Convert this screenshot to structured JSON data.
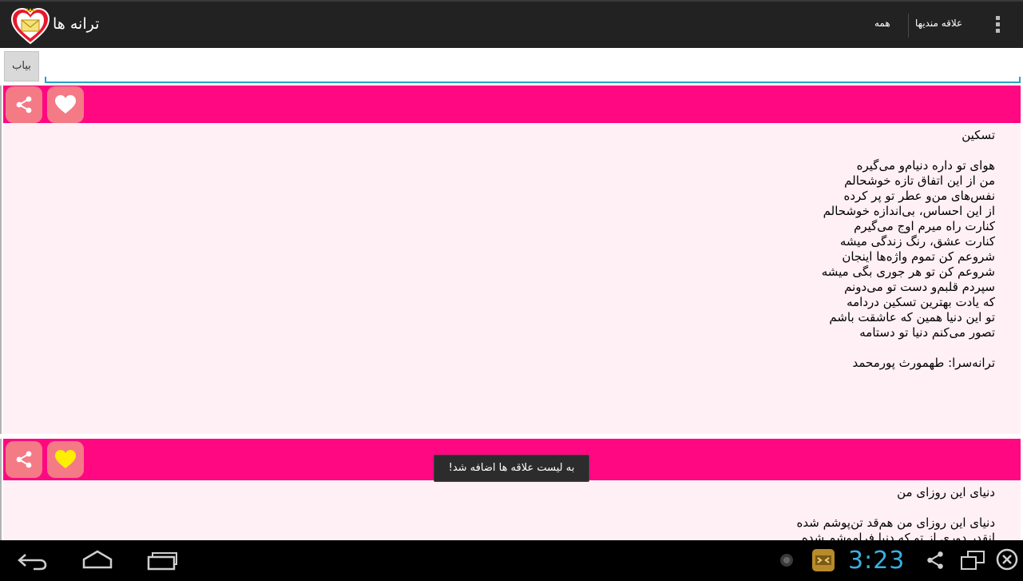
{
  "app": {
    "title": "ترانه ها",
    "tabs": [
      "علاقه مندیها",
      "همه"
    ],
    "icon": "heart-envelope-icon"
  },
  "search": {
    "button_label": "بیاب",
    "placeholder": ""
  },
  "songs": [
    {
      "liked": false,
      "text": "تسکین\n\nهوای تو داره دنیام‌و می‌گیره\nمن از این اتفاق تازه خوشحالم\nنفس‌های من‌و عطر تو پر کرده\nاز این احساس، بی‌اندازه خوشحالم\nکنارت راه میرم اوج می‌گیرم\nکنارت عشق، رنگ زندگی میشه\nشروعم کن تموم واژه‌ها اینجان\nشروعم کن تو هر جوری بگی میشه\nسپردم قلبم‌و دست تو می‌دونم\nکه یادت بهترین تسکین دردامه\nتو این دنیا همین که عاشقت باشم\nتصور می‌کنم دنیا تو دستامه\n\nترانه‌سرا: طهمورث پورمحمد"
    },
    {
      "liked": true,
      "text": "دنیای این روزای من\n\nدنیای این روزای من هم‌قد تن‌پوشم شده\nانقدر دوری از تو که دنیا فراموشم شده"
    }
  ],
  "toast": "به لیست علاقه ها اضافه شد!",
  "status": {
    "clock": "3:23"
  },
  "colors": {
    "accent_pink": "#ff0882",
    "card_background": "#fff0f5",
    "icon_button": "#f47a86",
    "liked_heart": "#ffee00",
    "clock_blue": "#3ab0e0"
  }
}
